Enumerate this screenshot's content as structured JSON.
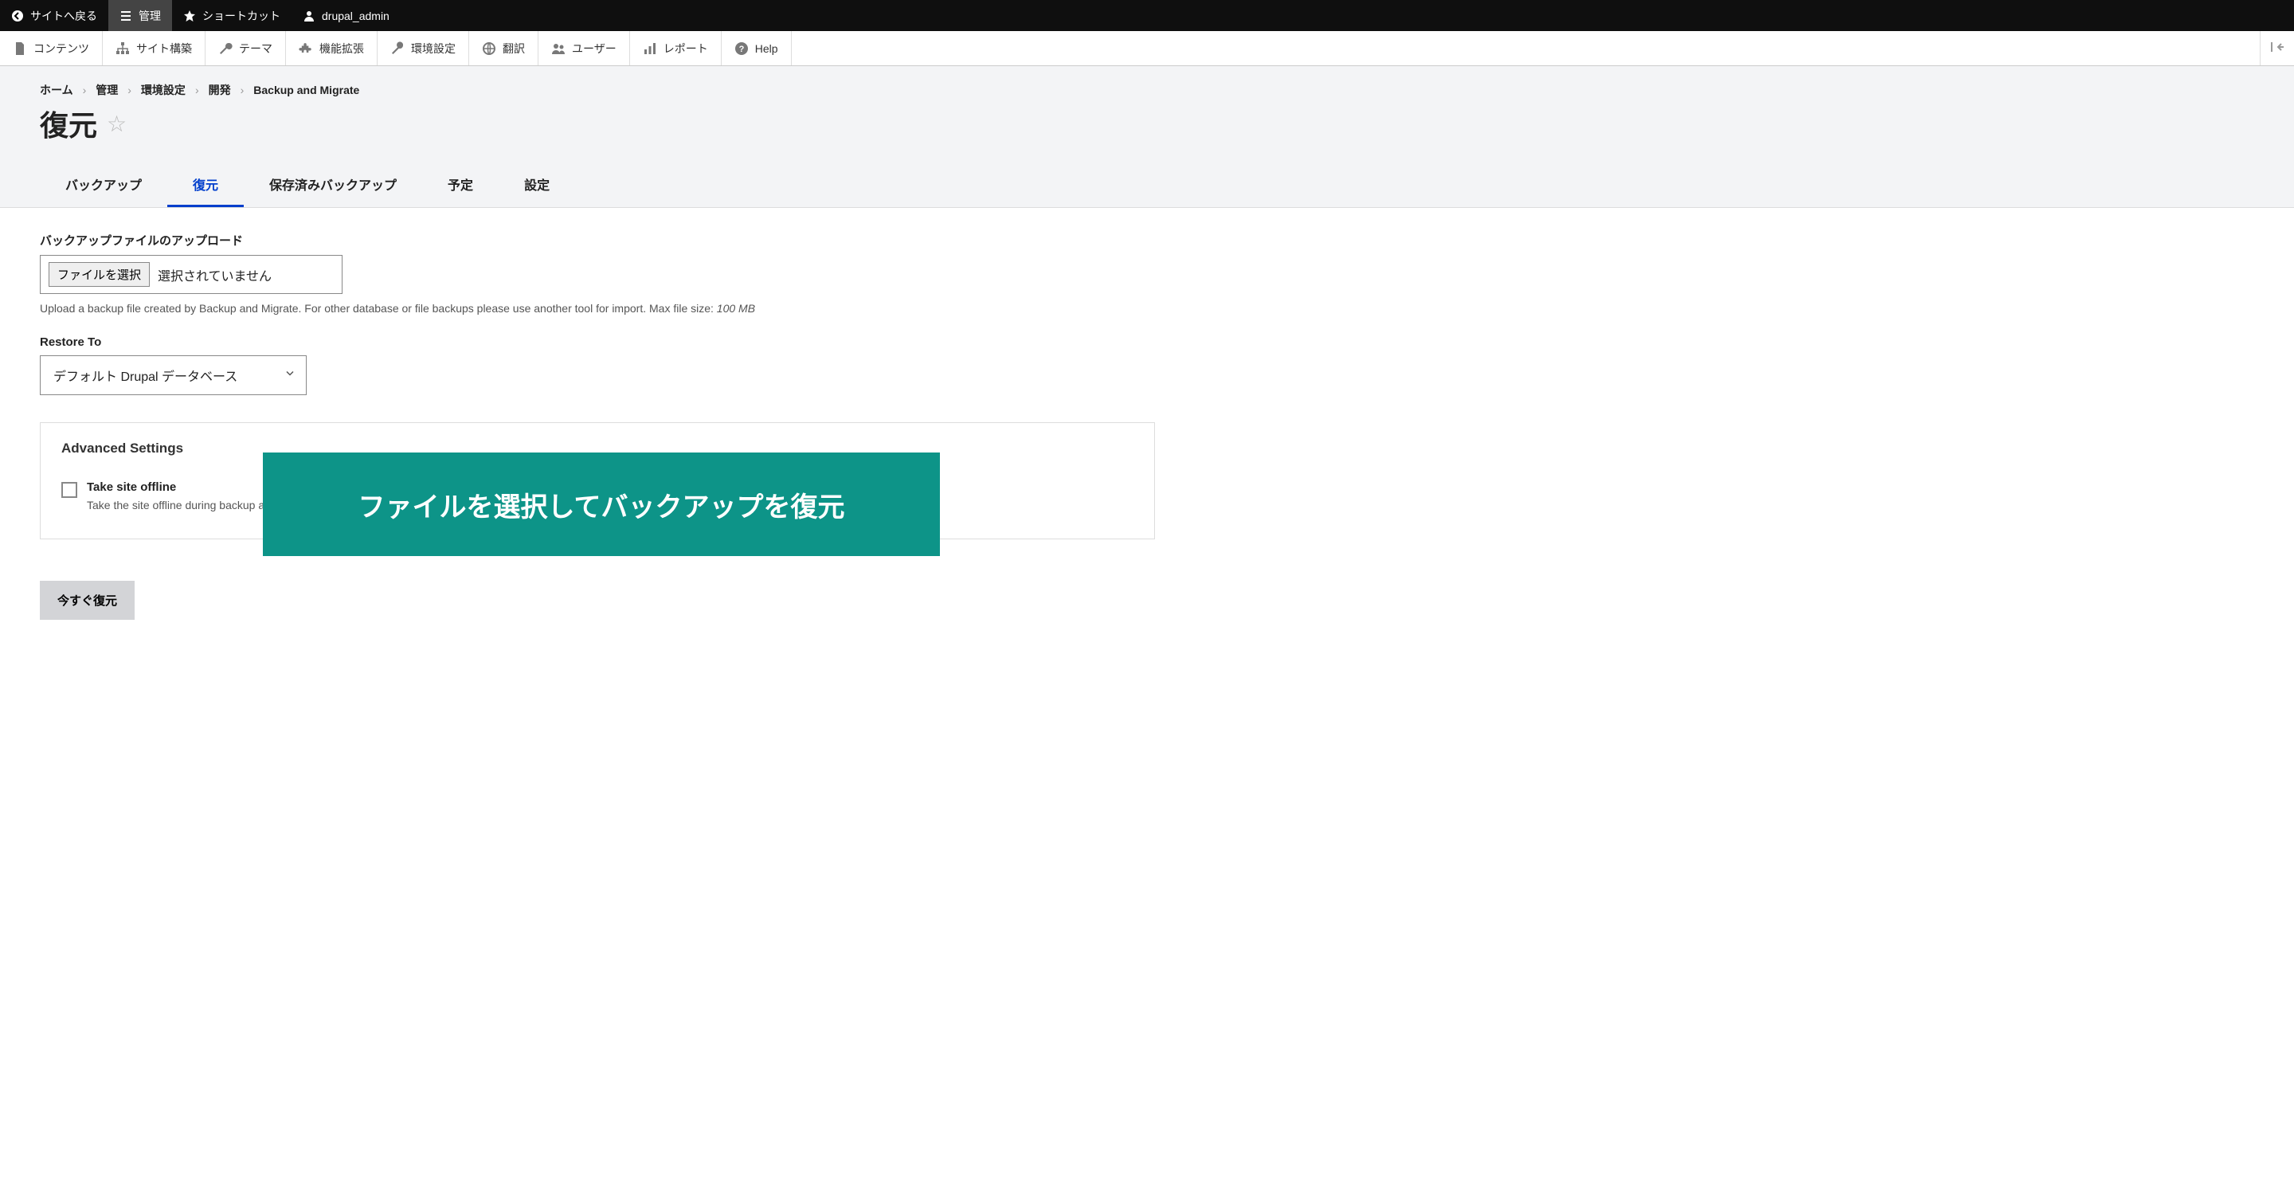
{
  "topbar": {
    "back_to_site": "サイトへ戻る",
    "manage": "管理",
    "shortcuts": "ショートカット",
    "user": "drupal_admin"
  },
  "toolbar2": {
    "content": "コンテンツ",
    "structure": "サイト構築",
    "appearance": "テーマ",
    "extend": "機能拡張",
    "configuration": "環境設定",
    "translate": "翻訳",
    "people": "ユーザー",
    "reports": "レポート",
    "help": "Help"
  },
  "breadcrumb": {
    "items": [
      "ホーム",
      "管理",
      "環境設定",
      "開発",
      "Backup and Migrate"
    ]
  },
  "page_title": "復元",
  "tabs": {
    "backup": "バックアップ",
    "restore": "復元",
    "saved": "保存済みバックアップ",
    "schedule": "予定",
    "settings": "設定"
  },
  "upload": {
    "label": "バックアップファイルのアップロード",
    "choose_button": "ファイルを選択",
    "no_file": "選択されていません",
    "help_prefix": "Upload a backup file created by Backup and Migrate. For other database or file backups please use another tool for import. Max file size: ",
    "help_size": "100 MB"
  },
  "restore_to": {
    "label": "Restore To",
    "selected": "デフォルト Drupal データベース"
  },
  "advanced": {
    "title": "Advanced Settings",
    "offline_label": "Take site offline",
    "offline_desc": "Take the site offline during backup a"
  },
  "submit_label": "今すぐ復元",
  "overlay_text": "ファイルを選択してバックアップを復元"
}
